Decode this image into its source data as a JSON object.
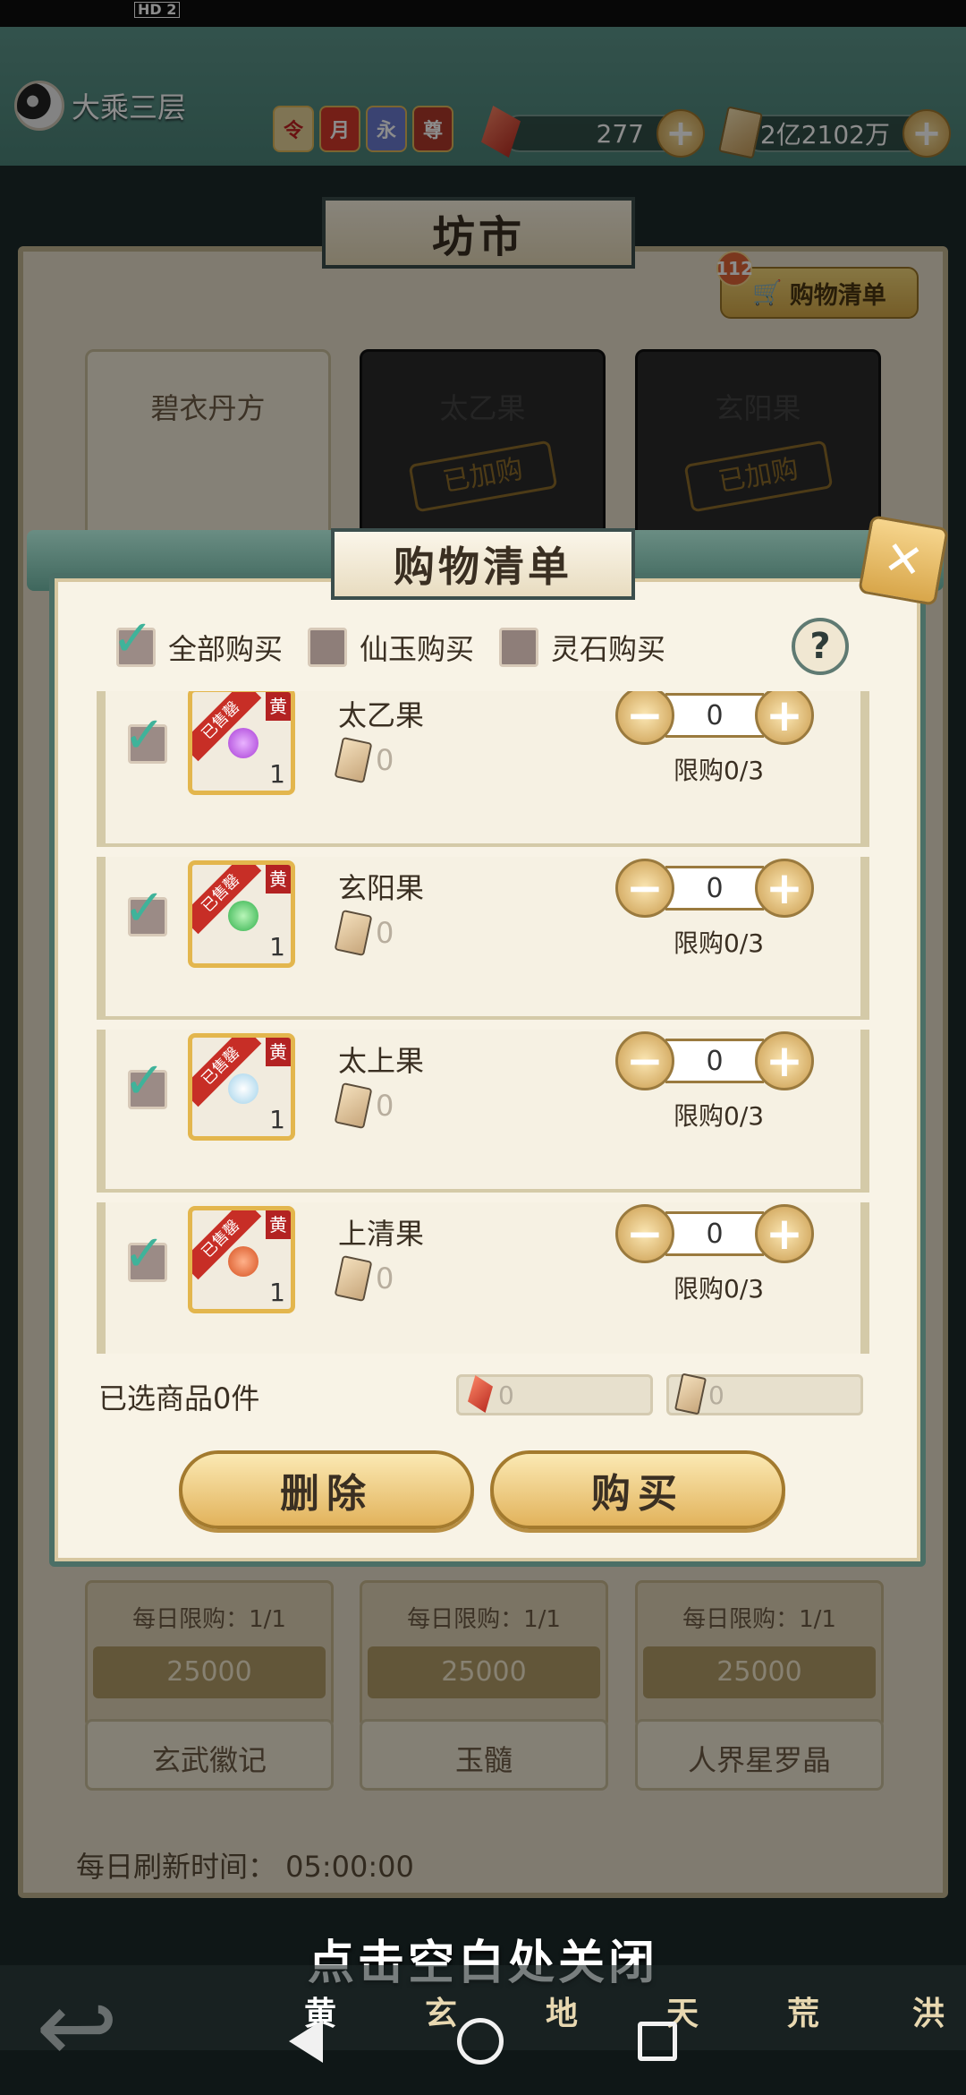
{
  "status_bar": {
    "hd": "HD 2"
  },
  "header": {
    "realm": "大乘三层",
    "badges": [
      "令",
      "月",
      "永",
      "尊"
    ],
    "currency_jade": "277",
    "currency_stone": "2亿2102万"
  },
  "market": {
    "title": "坊市",
    "cart_label": "购物清单",
    "cart_count": "112",
    "cards_top": [
      {
        "name": "碧衣丹方"
      },
      {
        "name": "太乙果",
        "added": "已加购"
      },
      {
        "name": "玄阳果",
        "added": "已加购"
      }
    ],
    "cards_bottom": [
      {
        "limit": "每日限购：1/1",
        "price": "25000"
      },
      {
        "limit": "每日限购：1/1",
        "price": "25000"
      },
      {
        "limit": "每日限购：1/1",
        "price": "25000"
      }
    ],
    "names_bottom": [
      "玄武徽记",
      "玉髓",
      "人界星罗晶"
    ],
    "refresh": "每日刷新时间： 05:00:00"
  },
  "dialog": {
    "title": "购物清单",
    "filters": [
      "全部购买",
      "仙玉购买",
      "灵石购买"
    ],
    "help": "?",
    "items": [
      {
        "name": "太乙果",
        "band": "已售罄",
        "grade": "黄",
        "qty": "1",
        "price": "0",
        "count": "0",
        "limit": "限购0/3",
        "fruit_color": "#a83cd6"
      },
      {
        "name": "玄阳果",
        "band": "已售罄",
        "grade": "黄",
        "qty": "1",
        "price": "0",
        "count": "0",
        "limit": "限购0/3",
        "fruit_color": "#2fb04a"
      },
      {
        "name": "太上果",
        "band": "已售罄",
        "grade": "黄",
        "qty": "1",
        "price": "0",
        "count": "0",
        "limit": "限购0/3",
        "fruit_color": "#c9e6f4"
      },
      {
        "name": "上清果",
        "band": "已售罄",
        "grade": "黄",
        "qty": "1",
        "price": "0",
        "count": "0",
        "limit": "限购0/3",
        "fruit_color": "#d6501f"
      }
    ],
    "selected": "已选商品0件",
    "total_jade": "0",
    "total_stone": "0",
    "delete_label": "删除",
    "buy_label": "购买"
  },
  "close_hint": "点击空白处关闭",
  "tabs": [
    "黄",
    "玄",
    "地",
    "天",
    "荒",
    "洪"
  ]
}
